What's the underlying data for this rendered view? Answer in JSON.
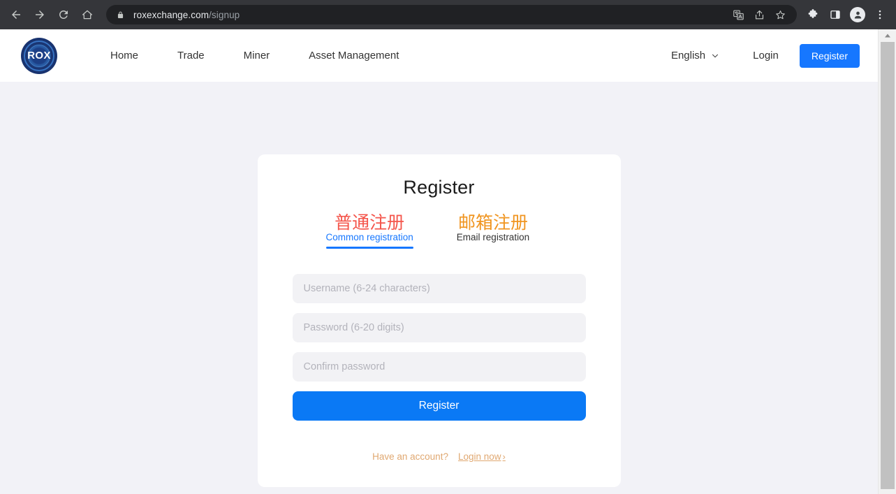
{
  "browser": {
    "back_label": "Back",
    "forward_label": "Forward",
    "reload_label": "Reload",
    "home_label": "Home",
    "url_domain": "roxexchange.com",
    "url_path": "/signup",
    "omnibox_icons": [
      "translate-icon",
      "share-icon",
      "bookmark-star-icon"
    ],
    "toolbar_icons": [
      "extensions-puzzle-icon",
      "side-panel-icon",
      "profile-avatar-icon",
      "browser-menu-icon"
    ]
  },
  "site": {
    "logo_text": "ROX",
    "nav": [
      {
        "label": "Home"
      },
      {
        "label": "Trade"
      },
      {
        "label": "Miner"
      },
      {
        "label": "Asset Management"
      }
    ],
    "language": {
      "label": "English",
      "chevron": "chevron-down-icon"
    },
    "login_label": "Login",
    "register_label": "Register"
  },
  "card": {
    "title": "Register",
    "tabs": [
      {
        "cn": "普通注册",
        "en": "Common registration",
        "active": true,
        "cn_color": "#f4554b",
        "en_color": "#1677ff"
      },
      {
        "cn": "邮箱注册",
        "en": "Email registration",
        "active": false,
        "cn_color": "#f09520",
        "en_color": "#333333"
      }
    ],
    "fields": {
      "username_placeholder": "Username (6-24 characters)",
      "username_value": "",
      "password_placeholder": "Password (6-20 digits)",
      "password_value": "",
      "confirm_placeholder": "Confirm password",
      "confirm_value": ""
    },
    "submit_label": "Register",
    "footer": {
      "question": "Have an account?",
      "link": "Login now",
      "chevron": "›"
    }
  },
  "colors": {
    "accent_blue": "#1677ff",
    "submit_blue": "#0a79f5",
    "tab_red": "#f4554b",
    "tab_orange": "#f09520",
    "footer_tan": "#e0a871",
    "page_bg": "#f2f2f7",
    "field_bg": "#f2f2f5",
    "chrome_bg": "#35363a"
  }
}
